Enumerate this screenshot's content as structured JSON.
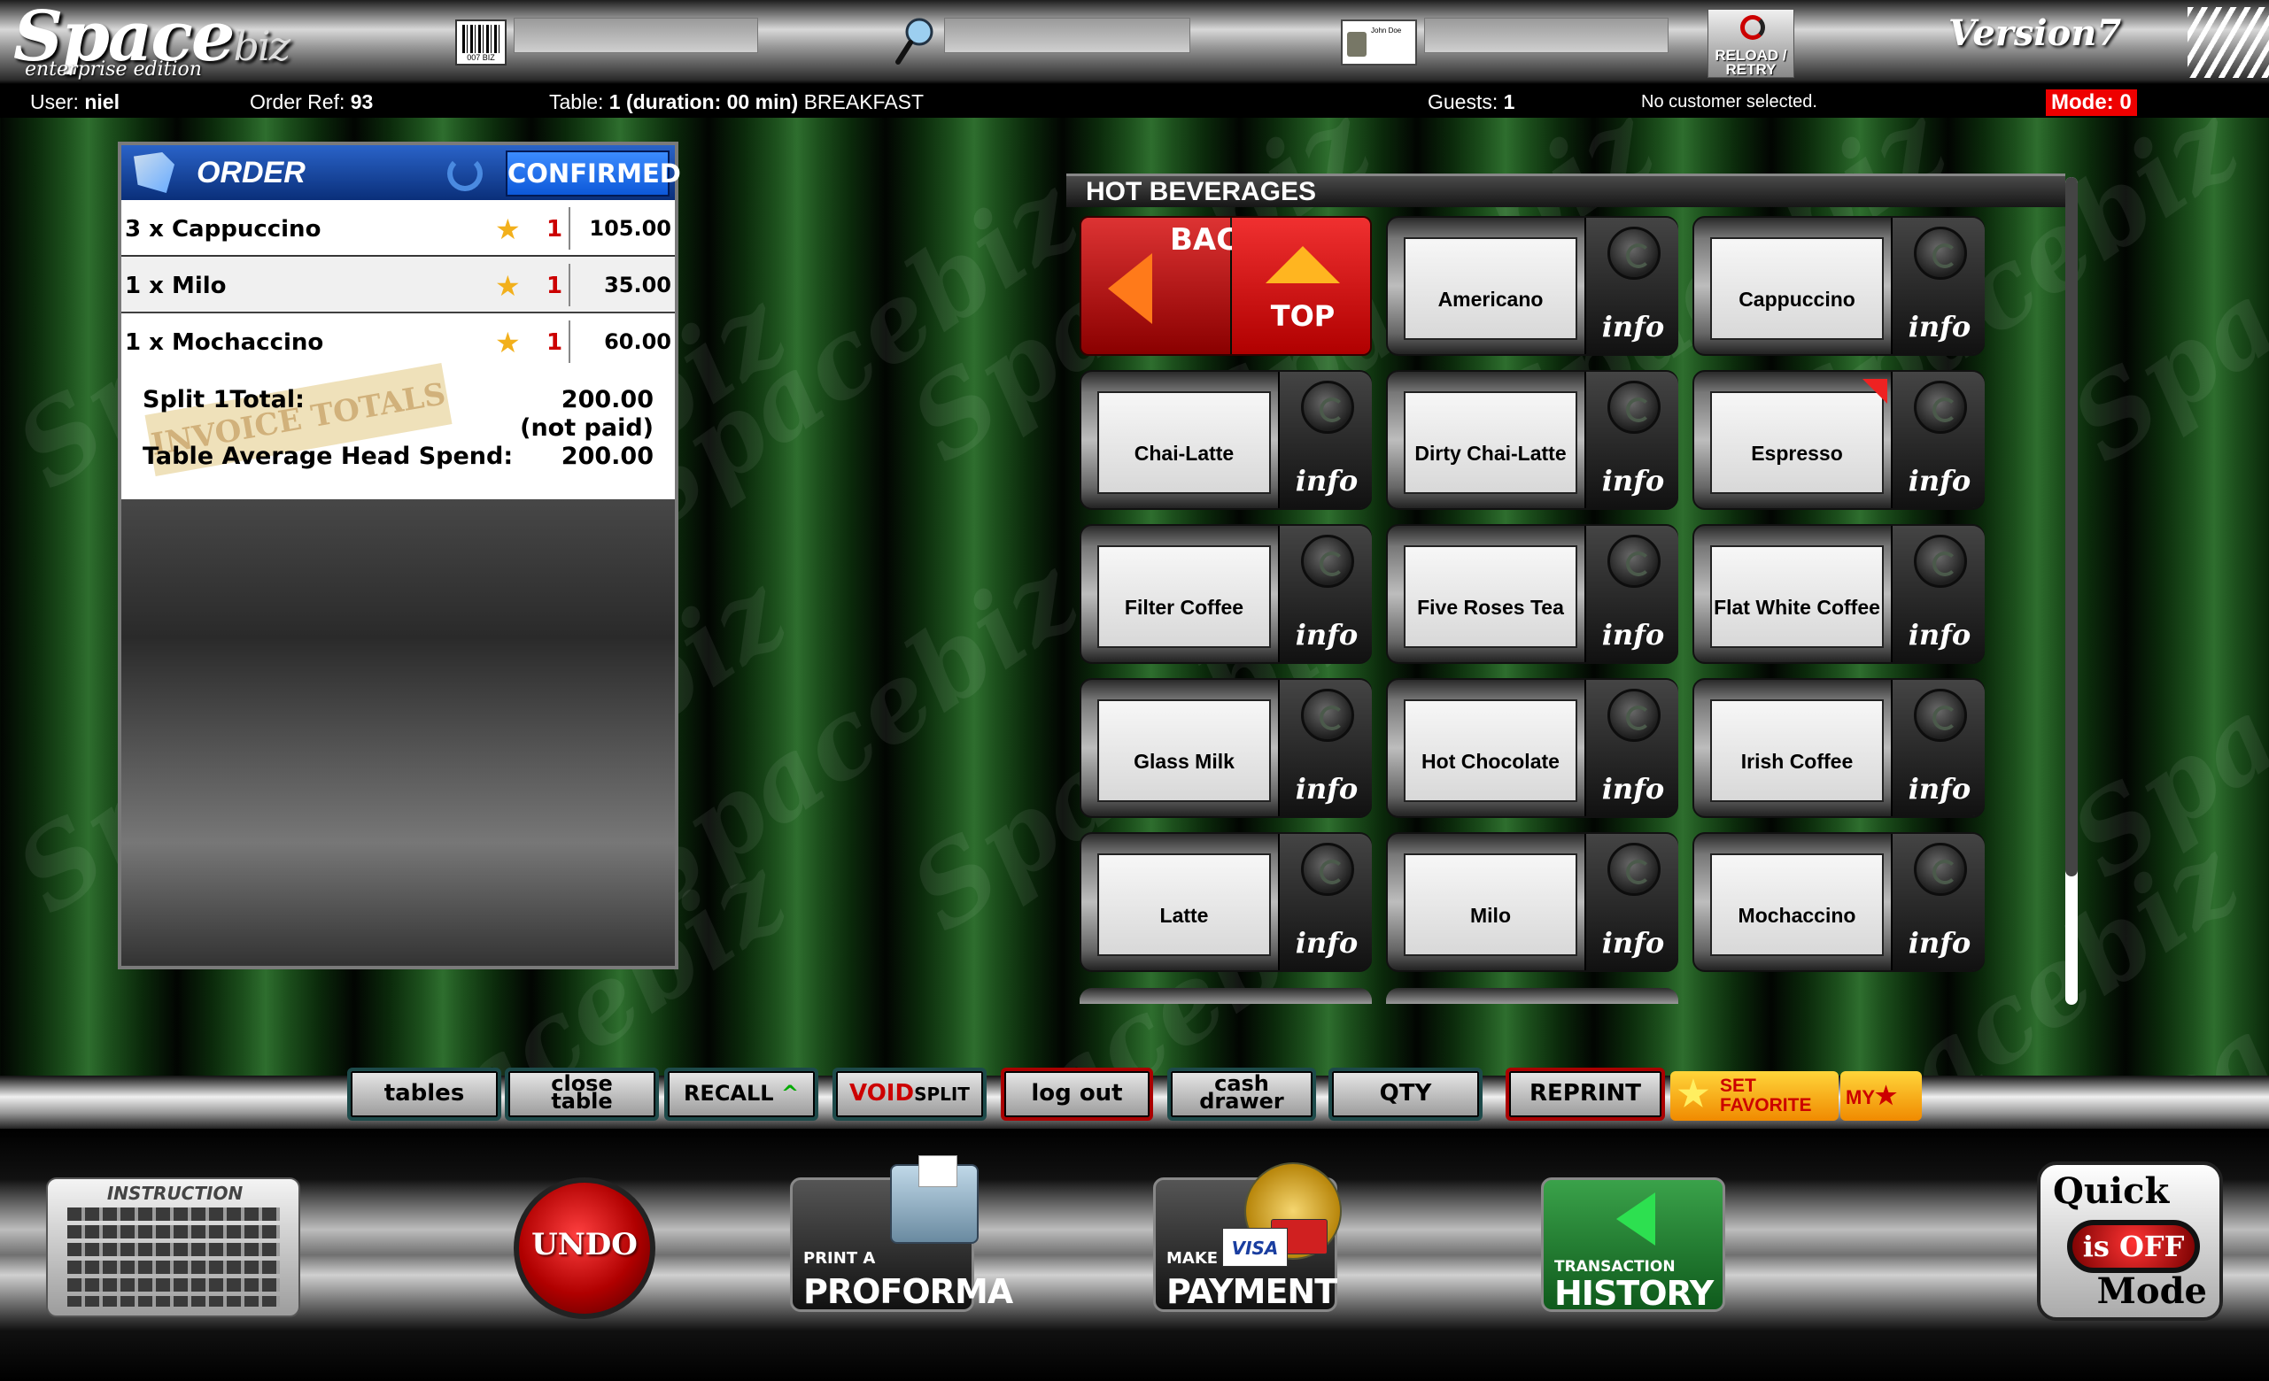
{
  "header": {
    "logo": "Space",
    "logo_suffix": "biz",
    "logo_sub": "enterprise edition",
    "barcode_text": "007 BIZ",
    "reload_label": "RELOAD / RETRY",
    "idcard_name": "John Doe",
    "version": "Version7"
  },
  "info": {
    "user_label": "User:",
    "user": "niel",
    "order_ref_label": "Order Ref:",
    "order_ref": "93",
    "table_label": "Table:",
    "table": "1 (duration: 00 min)",
    "table_suffix": "BREAKFAST",
    "guests_label": "Guests:",
    "guests": "1",
    "customer": "No customer selected.",
    "mode": "Mode: 0"
  },
  "order": {
    "title": "ORDER",
    "status": "CONFIRMED",
    "lines": [
      {
        "name": "3 x Cappuccino",
        "qty": "1",
        "price": "105.00"
      },
      {
        "name": "1 x Milo",
        "qty": "1",
        "price": "35.00"
      },
      {
        "name": "1 x Mochaccino",
        "qty": "1",
        "price": "60.00"
      }
    ],
    "stamp": "INVOICE TOTALS",
    "split_label": "Split 1Total:",
    "split_total": "200.00",
    "paid_status": "(not paid)",
    "avg_label": "Table Average Head Spend:",
    "avg_value": "200.00"
  },
  "menu": {
    "category": "HOT BEVERAGES",
    "back_label": "BACK",
    "top_label": "TOP",
    "info_label": "info",
    "items": [
      "Americano",
      "Cappuccino",
      "Chai-Latte",
      "Dirty Chai-Latte",
      "Espresso",
      "Filter Coffee",
      "Five Roses Tea",
      "Flat White Coffee",
      "Glass Milk",
      "Hot Chocolate",
      "Irish Coffee",
      "Latte",
      "Milo",
      "Mochaccino"
    ]
  },
  "toolbar": {
    "tables": "tables",
    "close_table_1": "close",
    "close_table_2": "table",
    "recall": "RECALL",
    "void": "VOID",
    "split": "SPLIT",
    "logout": "log out",
    "cash_1": "cash",
    "cash_2": "drawer",
    "qty": "QTY",
    "reprint": "REPRINT",
    "fav_1": "SET",
    "fav_2": "FAVORITE",
    "my": "MY"
  },
  "bottom": {
    "instruction": "INSTRUCTION",
    "undo": "UNDO",
    "print_small": "PRINT A",
    "print_large": "PROFORMA",
    "pay_small": "MAKE",
    "pay_large": "PAYMENT",
    "card": "VISA",
    "hist_small": "TRANSACTION",
    "hist_large": "HISTORY",
    "quick_1": "Quick",
    "quick_state": "is OFF",
    "quick_2": "Mode"
  }
}
